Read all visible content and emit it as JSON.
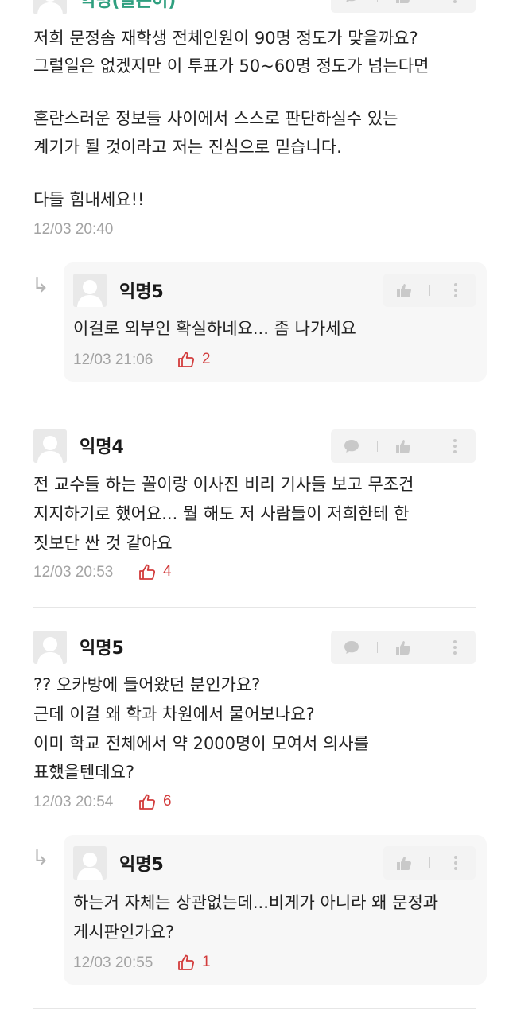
{
  "comments": [
    {
      "author": "익명(글쓴이)",
      "lines": [
        "저희 문정솜 재학생 전체인원이 90명 정도가 맞을까요?",
        "그럴일은 없겠지만 이 투표가 50~60명 정도가 넘는다면",
        "",
        "혼란스러운 정보들 사이에서 스스로 판단하실수 있는",
        "계기가 될 것이라고 저는 진심으로 믿습니다.",
        "",
        "다들 힘내세요!!"
      ],
      "time": "12/03 20:40"
    },
    {
      "author": "익명5",
      "is_reply": true,
      "lines": [
        "이걸로 외부인 확실하네요... 좀 나가세요"
      ],
      "time": "12/03 21:06",
      "likes": "2"
    },
    {
      "author": "익명4",
      "lines": [
        "전 교수들 하는 꼴이랑 이사진 비리 기사들 보고 무조건",
        "지지하기로 했어요... 뭘 해도 저 사람들이 저희한테 한",
        "짓보단 싼 것 같아요"
      ],
      "time": "12/03 20:53",
      "likes": "4"
    },
    {
      "author": "익명5",
      "lines": [
        "?? 오카방에 들어왔던 분인가요?",
        "근데 이걸 왜 학과 차원에서 물어보나요?",
        "이미 학교 전체에서 약 2000명이 모여서 의사를",
        "표했을텐데요?"
      ],
      "time": "12/03 20:54",
      "likes": "6"
    },
    {
      "author": "익명5",
      "is_reply": true,
      "lines": [
        "하는거 자체는 상관없는데...비게가 아니라 왜 문정과",
        "게시판인가요?"
      ],
      "time": "12/03 20:55",
      "likes": "1"
    }
  ],
  "icons": {
    "comment": "speech-bubble-icon",
    "like": "thumbs-up-icon",
    "more": "more-vertical-icon",
    "reply_arrow": "reply-arrow-icon",
    "vote": "thumbs-up-outline-icon"
  },
  "reply_arrow_glyph": "↳",
  "colors": {
    "author_op": "#2f9f7f",
    "vote": "#d23b3b",
    "meta": "#a3a3a3"
  }
}
